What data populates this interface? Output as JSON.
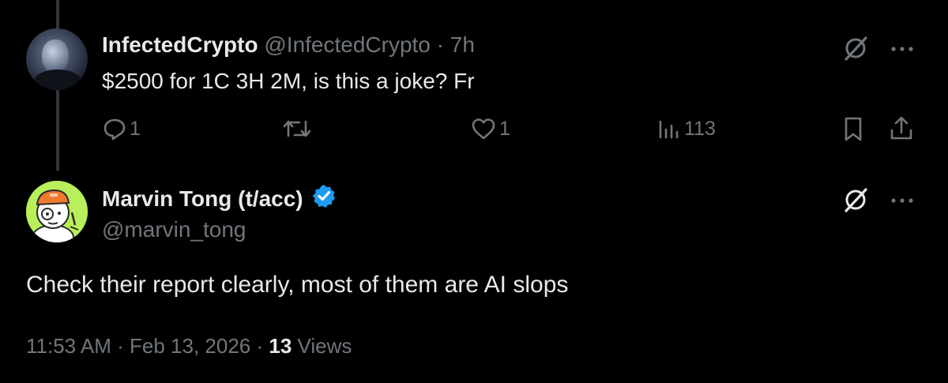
{
  "reply_tweet": {
    "display_name": "InfectedCrypto",
    "handle": "@InfectedCrypto",
    "separator": " · ",
    "time_ago": "7h",
    "text": "$2500 for 1C 3H 2M, is this a joke? Fr",
    "actions": {
      "replies": "1",
      "retweets": "",
      "likes": "1",
      "views": "113"
    },
    "icons": [
      "grok-icon",
      "more-icon",
      "reply-icon",
      "retweet-icon",
      "like-icon",
      "views-icon",
      "bookmark-icon",
      "share-icon"
    ]
  },
  "main_tweet": {
    "display_name": "Marvin Tong (t/acc)",
    "handle": "@marvin_tong",
    "verified": true,
    "text": "Check their report clearly, most of them are AI slops",
    "timestamp": "11:53 AM · Feb 13, 2026 · ",
    "views_count": "13",
    "views_label": " Views"
  },
  "colors": {
    "background": "#000000",
    "primary_text": "#e7e9ea",
    "secondary_text": "#71767b",
    "thread_line": "#333639",
    "verified_blue": "#1d9bf0",
    "avatar_green": "#b8ef5a"
  }
}
